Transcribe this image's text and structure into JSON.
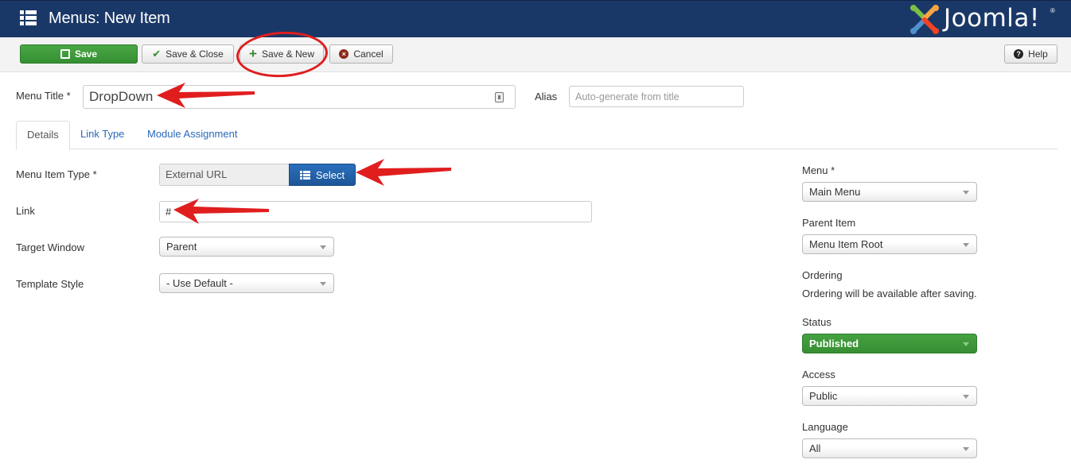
{
  "header": {
    "title": "Menus: New Item",
    "brand": "Joomla!",
    "brand_word": "Joomla!",
    "brand_reg": "®",
    "icon": "menu-list-icon"
  },
  "toolbar": {
    "save_label": "Save",
    "save_close_label": "Save & Close",
    "save_new_label": "Save & New",
    "cancel_label": "Cancel",
    "help_label": "Help",
    "icons": {
      "save": "edit-icon",
      "save_close": "check-icon",
      "save_new": "plus-icon",
      "cancel": "cancel-circle-icon",
      "help": "question-circle-icon"
    }
  },
  "form": {
    "menu_title_label": "Menu Title *",
    "menu_title_value": "DropDown",
    "alias_label": "Alias",
    "alias_placeholder": "Auto-generate from title"
  },
  "tabs": [
    {
      "label": "Details",
      "active": true
    },
    {
      "label": "Link Type",
      "active": false
    },
    {
      "label": "Module Assignment",
      "active": false
    }
  ],
  "details": {
    "menu_item_type_label": "Menu Item Type *",
    "menu_item_type_value": "External URL",
    "select_label": "Select",
    "link_label": "Link",
    "link_value": "#",
    "target_window_label": "Target Window",
    "target_window_value": "Parent",
    "template_style_label": "Template Style",
    "template_style_value": "- Use Default -"
  },
  "sidebar": {
    "menu_label": "Menu *",
    "menu_value": "Main Menu",
    "parent_label": "Parent Item",
    "parent_value": "Menu Item Root",
    "ordering_label": "Ordering",
    "ordering_note": "Ordering will be available after saving.",
    "status_label": "Status",
    "status_value": "Published",
    "access_label": "Access",
    "access_value": "Public",
    "language_label": "Language",
    "language_value": "All"
  },
  "colors": {
    "header_bg": "#1a3867",
    "save_green": "#3a9a36",
    "select_blue": "#1d5697",
    "link_blue": "#2a69b8",
    "annotation_red": "#e01e1e"
  }
}
